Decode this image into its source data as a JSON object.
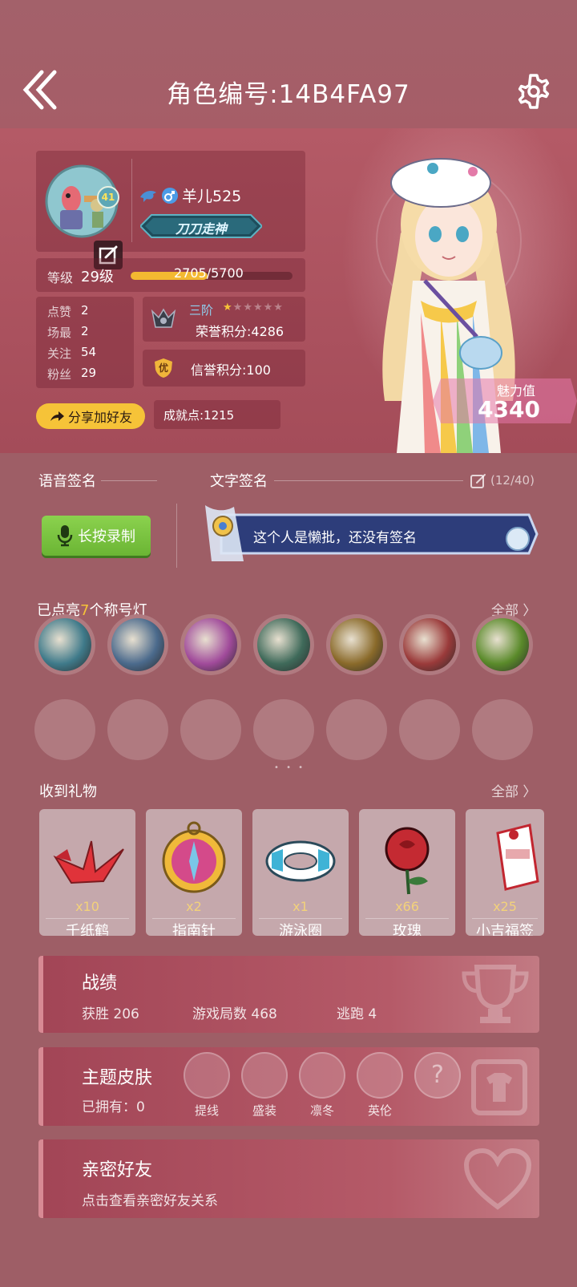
{
  "header": {
    "title": "角色编号:14B4FA97"
  },
  "profile": {
    "avatar_level": "41",
    "username": "羊儿525",
    "rank_badge": "刀刀走神",
    "level_label": "等级",
    "level_value": "29级",
    "xp_current": "2705",
    "xp_max": "5700",
    "xp_fraction": 0.4746,
    "stats": [
      {
        "label": "点赞",
        "value": "2"
      },
      {
        "label": "场最",
        "value": "2"
      },
      {
        "label": "关注",
        "value": "54"
      },
      {
        "label": "粉丝",
        "value": "29"
      }
    ],
    "tier": "三阶",
    "stars_filled": 1,
    "stars_total": 6,
    "honor_score": "荣誉积分:4286",
    "credit_badge": "优",
    "credit_score": "信誉积分:100",
    "share_button": "分享加好友",
    "achievement": "成就点:1215",
    "charm_label": "魅力值",
    "charm_value": "4340"
  },
  "signature": {
    "voice_label": "语音签名",
    "text_label": "文字签名",
    "count": "(12/40)",
    "record_button": "长按录制",
    "text": "这个人是懒批，还没有签名"
  },
  "titles": {
    "heading_prefix": "已点亮",
    "heading_count": "7",
    "heading_suffix": "个称号灯",
    "see_all": "全部 〉",
    "icons": [
      "wolf-icon",
      "tombstone-icon",
      "potion-icon",
      "crossbow-icon",
      "portrait-icon",
      "werewolf-icon",
      "cannon-icon"
    ]
  },
  "gifts": {
    "heading": "收到礼物",
    "see_all": "全部 〉",
    "items": [
      {
        "name": "千纸鹤",
        "count": "x10"
      },
      {
        "name": "指南针",
        "count": "x2"
      },
      {
        "name": "游泳圈",
        "count": "x1"
      },
      {
        "name": "玫瑰",
        "count": "x66"
      },
      {
        "name": "小吉福签",
        "count": "x25"
      }
    ]
  },
  "record": {
    "title": "战绩",
    "wins_label": "获胜",
    "wins": "206",
    "games_label": "游戏局数",
    "games": "468",
    "escape_label": "逃跑",
    "escape": "4"
  },
  "skins": {
    "title": "主题皮肤",
    "owned": "已拥有：0",
    "items": [
      "提线",
      "盛装",
      "凛冬",
      "英伦"
    ]
  },
  "friends": {
    "title": "亲密好友",
    "subtitle": "点击查看亲密好友关系"
  },
  "colors": {
    "accent_yellow": "#f6c338",
    "xp_bar": "#f3b931",
    "record_green": "#7cc441"
  }
}
